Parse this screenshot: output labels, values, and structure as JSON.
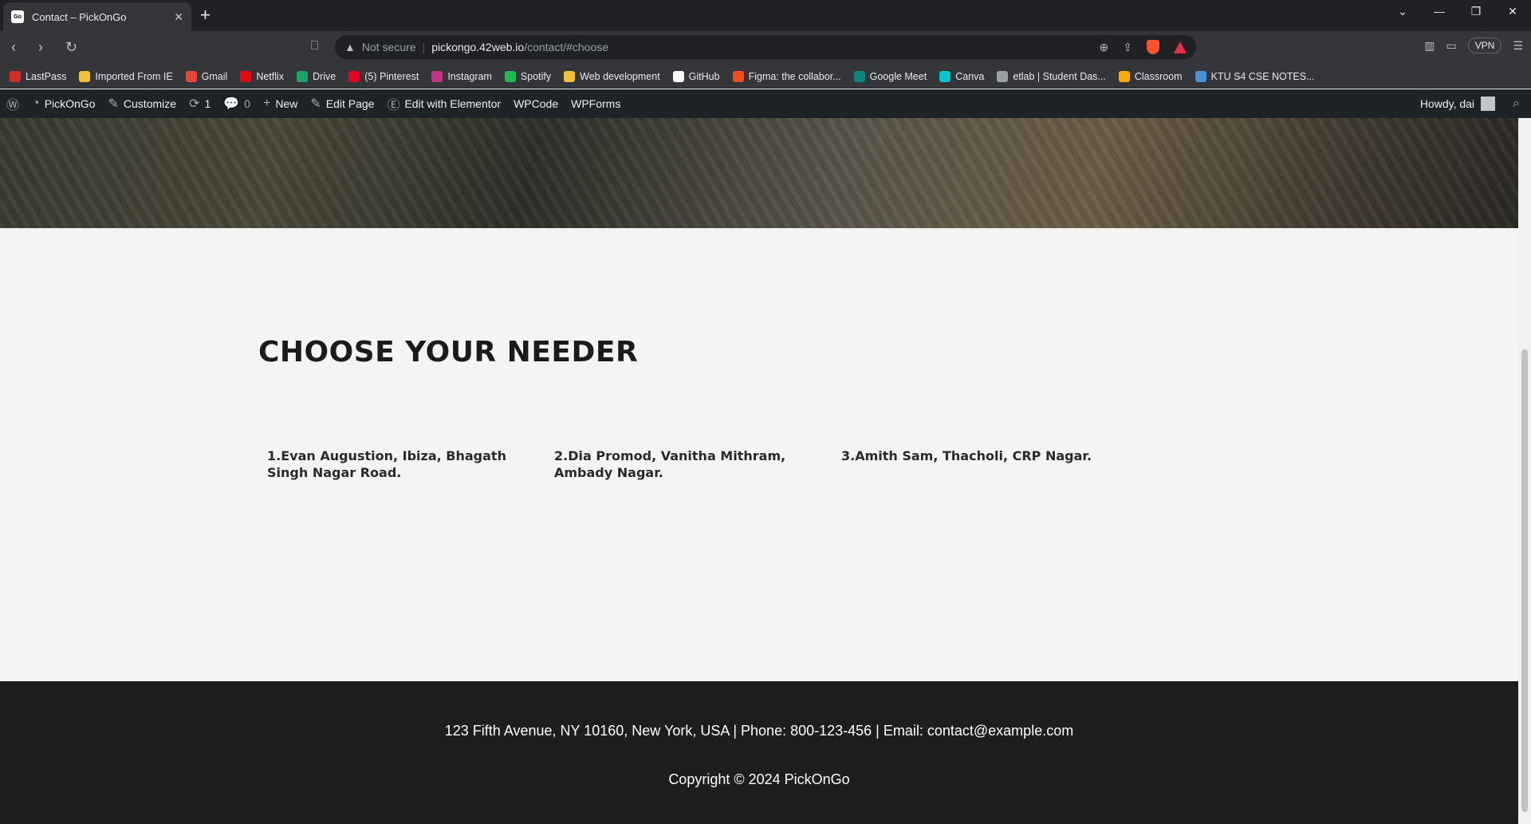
{
  "browser": {
    "tab_title": "Contact – PickOnGo",
    "tab_favicon_text": "Go",
    "new_tab_label": "+",
    "address": {
      "security_label": "Not secure",
      "host": "pickongo.42web.io",
      "path": "/contact/#choose"
    },
    "vpn_label": "VPN",
    "bookmarks": [
      {
        "label": "LastPass",
        "color": "#d32d27"
      },
      {
        "label": "Imported From IE",
        "color": "#f4c430"
      },
      {
        "label": "Gmail",
        "color": "#ea4335"
      },
      {
        "label": "Netflix",
        "color": "#e50914"
      },
      {
        "label": "Drive",
        "color": "#1fa463"
      },
      {
        "label": "(5) Pinterest",
        "color": "#e60023"
      },
      {
        "label": "Instagram",
        "color": "#c13584"
      },
      {
        "label": "Spotify",
        "color": "#1db954"
      },
      {
        "label": "Web development",
        "color": "#f4c430"
      },
      {
        "label": "GitHub",
        "color": "#ffffff"
      },
      {
        "label": "Figma: the collabor...",
        "color": "#f24e1e"
      },
      {
        "label": "Google Meet",
        "color": "#00897b"
      },
      {
        "label": "Canva",
        "color": "#00c4cc"
      },
      {
        "label": "etlab | Student Das...",
        "color": "#9aa0a6"
      },
      {
        "label": "Classroom",
        "color": "#f9ab00"
      },
      {
        "label": "KTU S4 CSE NOTES...",
        "color": "#4a90d9"
      }
    ]
  },
  "wp_admin_bar": {
    "site_name": "PickOnGo",
    "customize": "Customize",
    "updates_count": "1",
    "comments_count": "0",
    "new_label": "New",
    "edit_page": "Edit Page",
    "edit_elementor": "Edit with Elementor",
    "wpcode": "WPCode",
    "wpforms": "WPForms",
    "howdy": "Howdy, dai"
  },
  "section": {
    "heading": "CHOOSE YOUR NEEDER",
    "needers": [
      "1.Evan Augustion, Ibiza, Bhagath Singh Nagar Road.",
      "2.Dia Promod, Vanitha Mithram, Ambady Nagar.",
      "3.Amith Sam, Thacholi, CRP Nagar."
    ]
  },
  "footer": {
    "address_line": "123 Fifth Avenue, NY 10160, New York, USA | Phone: 800-123-456 | Email: contact@example.com",
    "copyright": "Copyright © 2024 PickOnGo"
  }
}
